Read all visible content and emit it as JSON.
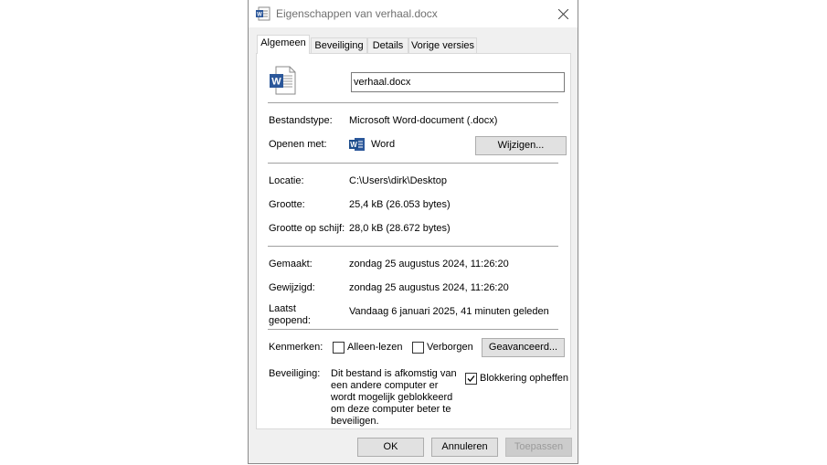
{
  "window": {
    "title": "Eigenschappen van verhaal.docx"
  },
  "tabs": [
    {
      "label": "Algemeen",
      "active": true
    },
    {
      "label": "Beveiliging",
      "active": false
    },
    {
      "label": "Details",
      "active": false
    },
    {
      "label": "Vorige versies",
      "active": false
    }
  ],
  "general": {
    "filename": "verhaal.docx",
    "type_label": "Bestandstype:",
    "type_value": "Microsoft Word-document (.docx)",
    "opens_label": "Openen met:",
    "opens_value": "Word",
    "change_button": "Wijzigen...",
    "location_label": "Locatie:",
    "location_value": "C:\\Users\\dirk\\Desktop",
    "size_label": "Grootte:",
    "size_value": "25,4 kB (26.053 bytes)",
    "disk_size_label": "Grootte op schijf:",
    "disk_size_value": "28,0 kB (28.672 bytes)",
    "created_label": "Gemaakt:",
    "created_value": "zondag 25 augustus 2024, 11:26:20",
    "modified_label": "Gewijzigd:",
    "modified_value": "zondag 25 augustus 2024, 11:26:20",
    "accessed_label": "Laatst geopend:",
    "accessed_value": "Vandaag 6 januari 2025, 41 minuten geleden",
    "attributes_label": "Kenmerken:",
    "readonly_label": "Alleen-lezen",
    "readonly_checked": false,
    "hidden_label": "Verborgen",
    "hidden_checked": false,
    "advanced_button": "Geavanceerd...",
    "security_label": "Beveiliging:",
    "security_text": "Dit bestand is afkomstig van een andere computer er wordt mogelijk geblokkeerd om deze computer beter te beveiligen.",
    "unblock_label": "Blokkering opheffen",
    "unblock_checked": true
  },
  "footer": {
    "ok": "OK",
    "cancel": "Annuleren",
    "apply": "Toepassen"
  },
  "colors": {
    "word_blue": "#2b579a",
    "dialog_bg": "#f0f0f0",
    "panel_bg": "#ffffff"
  }
}
